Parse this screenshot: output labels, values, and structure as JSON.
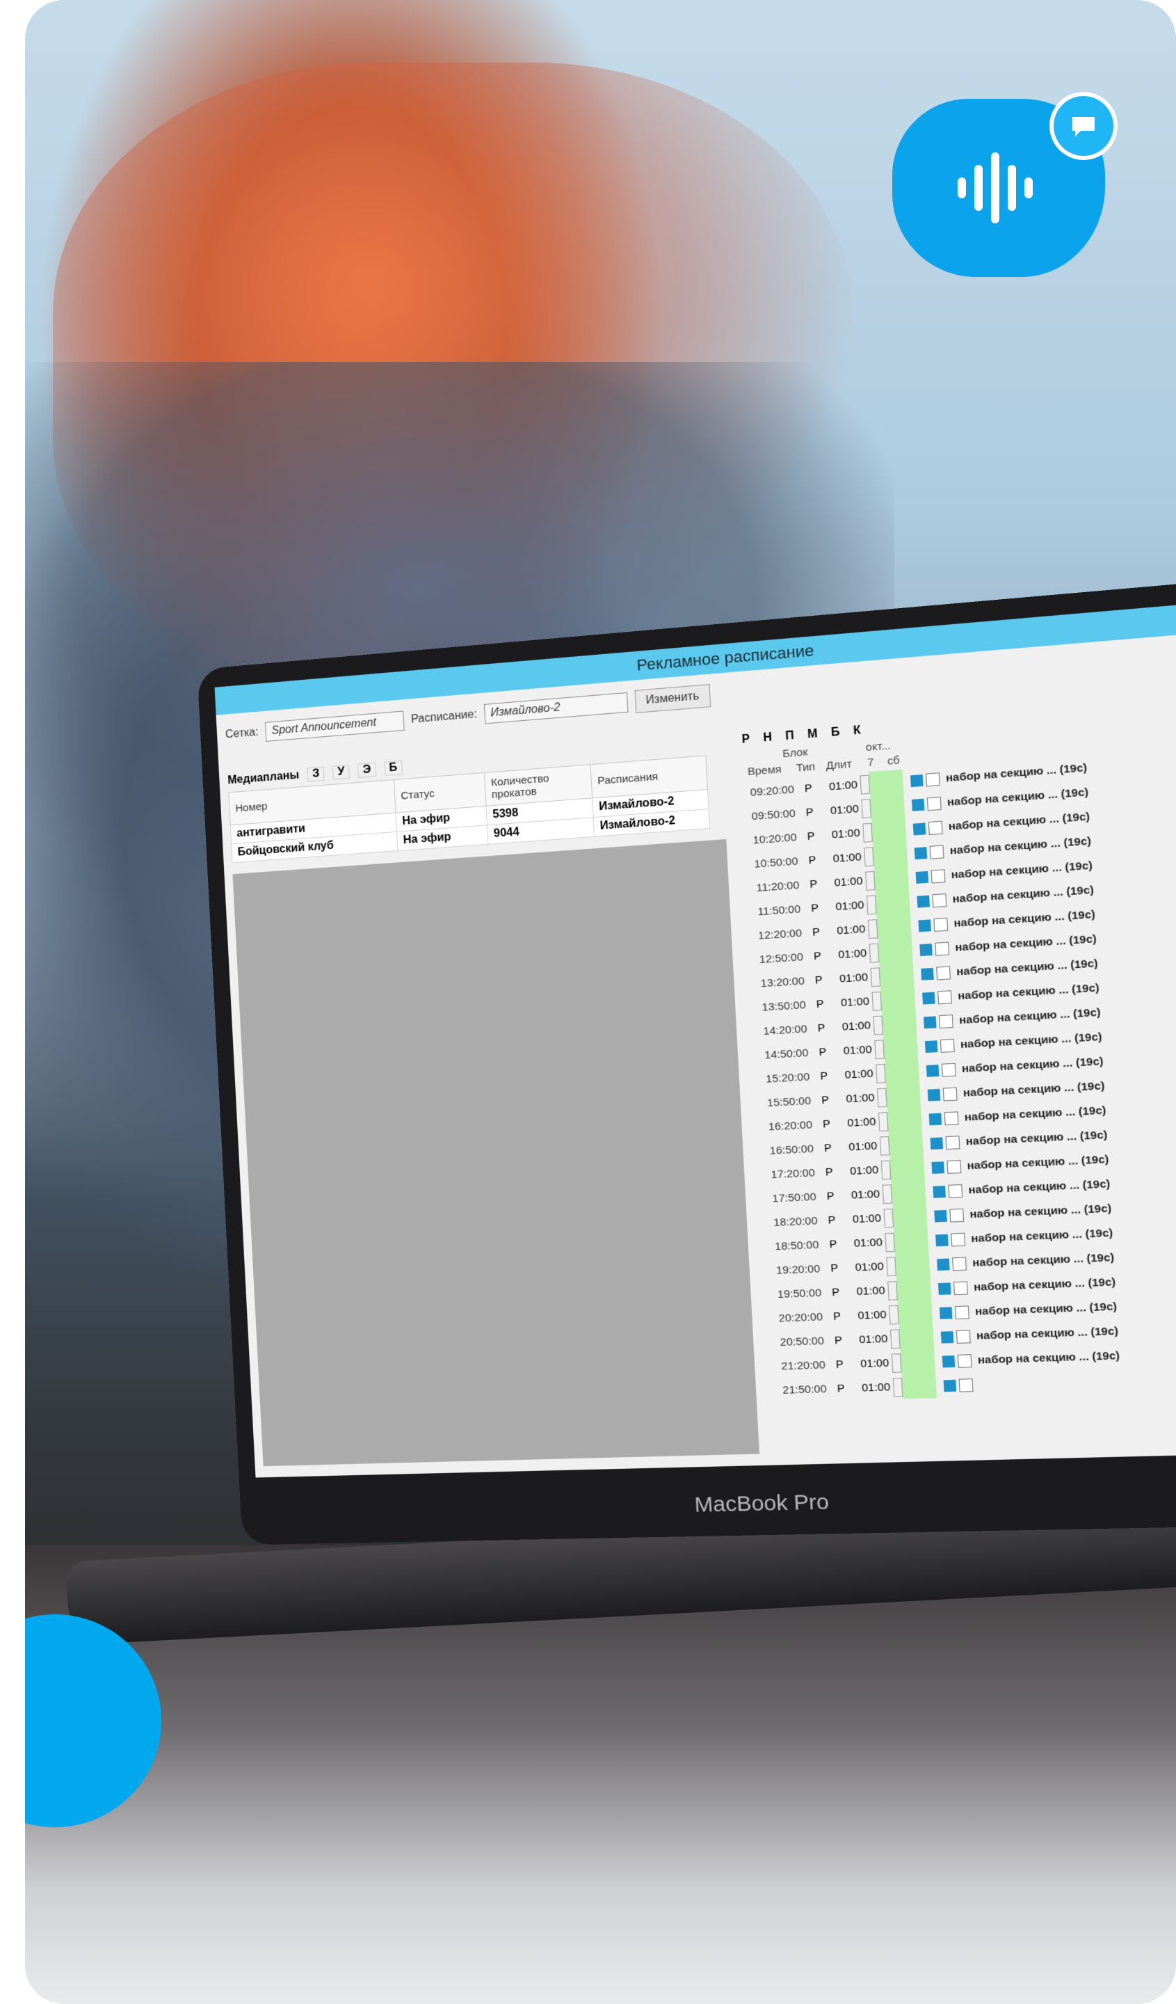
{
  "logo": {
    "icon": "sound-wave-icon",
    "badge_icon": "chat-bubble-icon",
    "color": "#0aa3ec"
  },
  "device": {
    "brand": "MacBook Pro"
  },
  "window": {
    "title": "Рекламное расписание"
  },
  "filters": {
    "grid_label": "Сетка:",
    "grid_value": "Sport Announcement",
    "schedule_label": "Расписание:",
    "schedule_value": "Измайлово-2",
    "change_button": "Изменить"
  },
  "mediaplans": {
    "title": "Медиапланы",
    "keys": [
      "З",
      "У",
      "Э",
      "Б"
    ],
    "columns": [
      "Номер",
      "Статус",
      "Количество прокатов",
      "Расписания"
    ],
    "rows": [
      {
        "name": "антигравити",
        "status": "На эфир",
        "count": "5398",
        "schedule": "Измайлово-2"
      },
      {
        "name": "Бойцовский клуб",
        "status": "На эфир",
        "count": "9044",
        "schedule": "Измайлово-2"
      }
    ]
  },
  "schedule": {
    "flags": [
      "Р",
      "Н",
      "П",
      "М",
      "Б",
      "К"
    ],
    "header": {
      "block": "Блок",
      "time": "Время",
      "type": "Тип",
      "dur": "Длит",
      "month": "окт...",
      "day": "7",
      "weekday": "сб"
    },
    "rows": [
      {
        "time": "09:20:00",
        "type": "Р",
        "dur": "01:00",
        "label": "набор на секцию ... (19с)"
      },
      {
        "time": "09:50:00",
        "type": "Р",
        "dur": "01:00",
        "label": "набор на секцию ... (19с)"
      },
      {
        "time": "10:20:00",
        "type": "Р",
        "dur": "01:00",
        "label": "набор на секцию ... (19с)"
      },
      {
        "time": "10:50:00",
        "type": "Р",
        "dur": "01:00",
        "label": "набор на секцию ... (19с)"
      },
      {
        "time": "11:20:00",
        "type": "Р",
        "dur": "01:00",
        "label": "набор на секцию ... (19с)"
      },
      {
        "time": "11:50:00",
        "type": "Р",
        "dur": "01:00",
        "label": "набор на секцию ... (19с)"
      },
      {
        "time": "12:20:00",
        "type": "Р",
        "dur": "01:00",
        "label": "набор на секцию ... (19с)"
      },
      {
        "time": "12:50:00",
        "type": "Р",
        "dur": "01:00",
        "label": "набор на секцию ... (19с)"
      },
      {
        "time": "13:20:00",
        "type": "Р",
        "dur": "01:00",
        "label": "набор на секцию ... (19с)"
      },
      {
        "time": "13:50:00",
        "type": "Р",
        "dur": "01:00",
        "label": "набор на секцию ... (19с)"
      },
      {
        "time": "14:20:00",
        "type": "Р",
        "dur": "01:00",
        "label": "набор на секцию ... (19с)"
      },
      {
        "time": "14:50:00",
        "type": "Р",
        "dur": "01:00",
        "label": "набор на секцию ... (19с)"
      },
      {
        "time": "15:20:00",
        "type": "Р",
        "dur": "01:00",
        "label": "набор на секцию ... (19с)"
      },
      {
        "time": "15:50:00",
        "type": "Р",
        "dur": "01:00",
        "label": "набор на секцию ... (19с)"
      },
      {
        "time": "16:20:00",
        "type": "Р",
        "dur": "01:00",
        "label": "набор на секцию ... (19с)"
      },
      {
        "time": "16:50:00",
        "type": "Р",
        "dur": "01:00",
        "label": "набор на секцию ... (19с)"
      },
      {
        "time": "17:20:00",
        "type": "Р",
        "dur": "01:00",
        "label": "набор на секцию ... (19с)"
      },
      {
        "time": "17:50:00",
        "type": "Р",
        "dur": "01:00",
        "label": "набор на секцию ... (19с)"
      },
      {
        "time": "18:20:00",
        "type": "Р",
        "dur": "01:00",
        "label": "набор на секцию ... (19с)"
      },
      {
        "time": "18:50:00",
        "type": "Р",
        "dur": "01:00",
        "label": "набор на секцию ... (19с)"
      },
      {
        "time": "19:20:00",
        "type": "Р",
        "dur": "01:00",
        "label": "набор на секцию ... (19с)"
      },
      {
        "time": "19:50:00",
        "type": "Р",
        "dur": "01:00",
        "label": "набор на секцию ... (19с)"
      },
      {
        "time": "20:20:00",
        "type": "Р",
        "dur": "01:00",
        "label": "набор на секцию ... (19с)"
      },
      {
        "time": "20:50:00",
        "type": "Р",
        "dur": "01:00",
        "label": "набор на секцию ... (19с)"
      },
      {
        "time": "21:20:00",
        "type": "Р",
        "dur": "01:00",
        "label": "набор на секцию ... (19с)"
      },
      {
        "time": "21:50:00",
        "type": "Р",
        "dur": "01:00",
        "label": ""
      }
    ]
  },
  "colors": {
    "accent": "#02a8ee",
    "titlebar": "#5bc8ee",
    "cell_green": "#b6f0a9",
    "marker": "#1d8fc9"
  }
}
